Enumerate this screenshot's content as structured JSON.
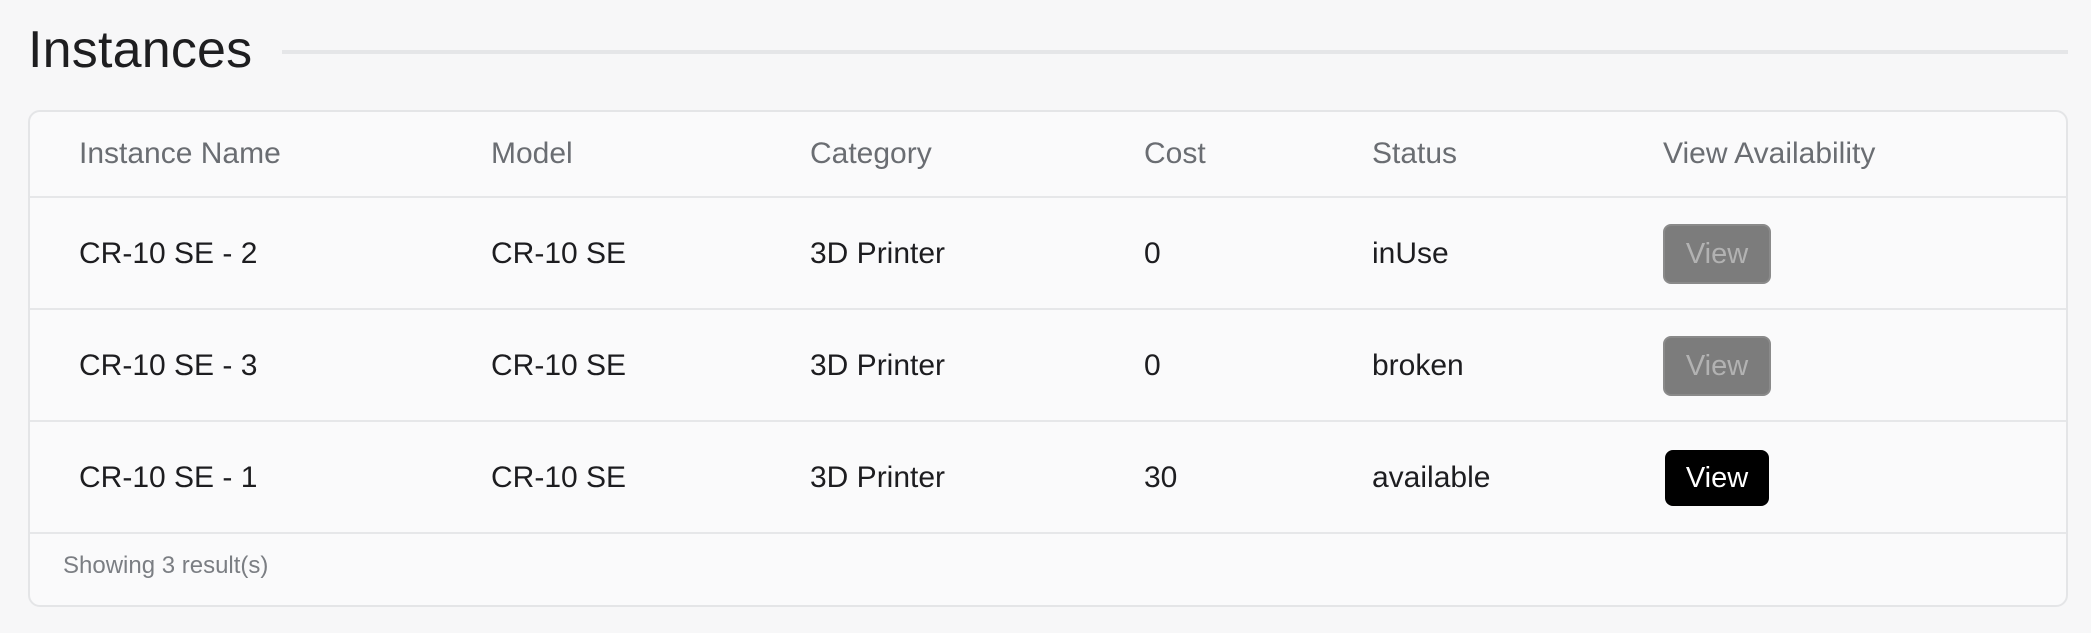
{
  "section": {
    "title": "Instances"
  },
  "table": {
    "columns": [
      "Instance Name",
      "Model",
      "Category",
      "Cost",
      "Status",
      "View Availability"
    ],
    "rows": [
      {
        "name": "CR-10 SE - 2",
        "model": "CR-10 SE",
        "category": "3D Printer",
        "cost": "0",
        "status": "inUse",
        "action_label": "View",
        "action_enabled": false
      },
      {
        "name": "CR-10 SE - 3",
        "model": "CR-10 SE",
        "category": "3D Printer",
        "cost": "0",
        "status": "broken",
        "action_label": "View",
        "action_enabled": false
      },
      {
        "name": "CR-10 SE - 1",
        "model": "CR-10 SE",
        "category": "3D Printer",
        "cost": "30",
        "status": "available",
        "action_label": "View",
        "action_enabled": true
      }
    ],
    "footer": "Showing 3 result(s)"
  },
  "colors": {
    "enabled_button": "#000000",
    "disabled_button": "#7c7c7c",
    "background": "#f7f7f8"
  }
}
